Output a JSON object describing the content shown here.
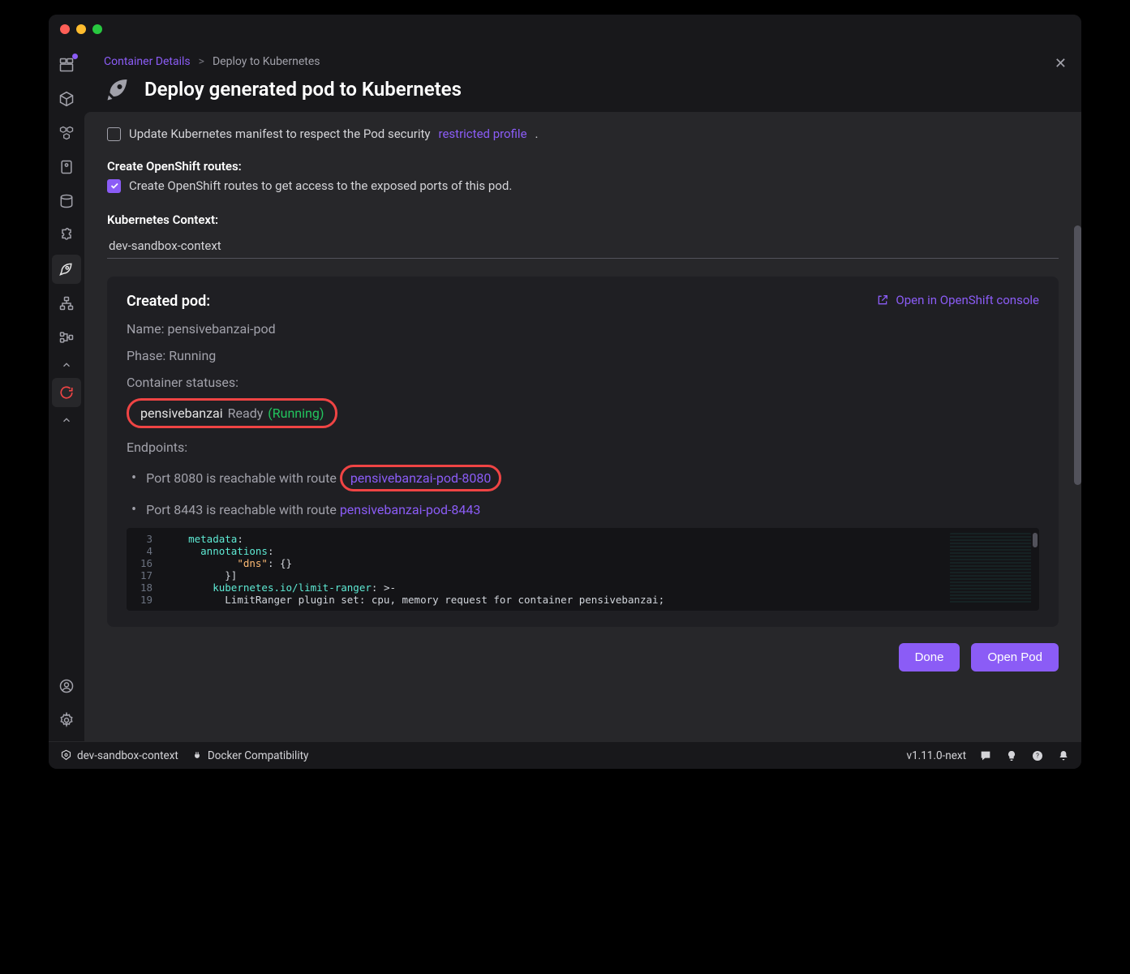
{
  "breadcrumb": {
    "parent": "Container Details",
    "current": "Deploy to Kubernetes"
  },
  "page_title": "Deploy generated pod to Kubernetes",
  "manifest_checkbox": {
    "label_prefix": "Update Kubernetes manifest to respect the Pod security",
    "link_text": "restricted profile",
    "suffix": "."
  },
  "routes_section": {
    "heading": "Create OpenShift routes:",
    "label": "Create OpenShift routes to get access to the exposed ports of this pod."
  },
  "context_section": {
    "heading": "Kubernetes Context:",
    "value": "dev-sandbox-context"
  },
  "pod_panel": {
    "title": "Created pod:",
    "open_console": "Open in OpenShift console",
    "name_label": "Name: ",
    "name_value": "pensivebanzai-pod",
    "phase_label": "Phase: ",
    "phase_value": "Running",
    "statuses_label": "Container statuses:",
    "container_name": "pensivebanzai",
    "container_ready": "Ready",
    "container_state": "(Running)",
    "endpoints_label": "Endpoints:",
    "endpoints": [
      {
        "prefix": "Port 8080 is reachable with route",
        "route": "pensivebanzai-pod-8080",
        "highlighted": true
      },
      {
        "prefix": "Port 8443 is reachable with route",
        "route": "pensivebanzai-pod-8443",
        "highlighted": false
      }
    ]
  },
  "yaml": {
    "lines": [
      {
        "n": "3",
        "indent": 4,
        "segs": [
          [
            "k",
            "metadata"
          ],
          [
            "p",
            ":"
          ]
        ]
      },
      {
        "n": "4",
        "indent": 6,
        "segs": [
          [
            "k",
            "annotations"
          ],
          [
            "p",
            ":"
          ]
        ]
      },
      {
        "n": "16",
        "indent": 12,
        "segs": [
          [
            "s",
            "\"dns\""
          ],
          [
            "p",
            ": "
          ],
          [
            "b",
            "{}"
          ]
        ]
      },
      {
        "n": "17",
        "indent": 10,
        "segs": [
          [
            "b",
            "}]"
          ]
        ]
      },
      {
        "n": "18",
        "indent": 8,
        "segs": [
          [
            "k",
            "kubernetes.io/limit-ranger"
          ],
          [
            "p",
            ": >-"
          ]
        ]
      },
      {
        "n": "19",
        "indent": 10,
        "segs": [
          [
            "p",
            "LimitRanger plugin set: cpu, memory request for container pensivebanzai;"
          ]
        ]
      }
    ]
  },
  "buttons": {
    "done": "Done",
    "open_pod": "Open Pod"
  },
  "statusbar": {
    "context": "dev-sandbox-context",
    "docker": "Docker Compatibility",
    "version": "v1.11.0-next"
  }
}
